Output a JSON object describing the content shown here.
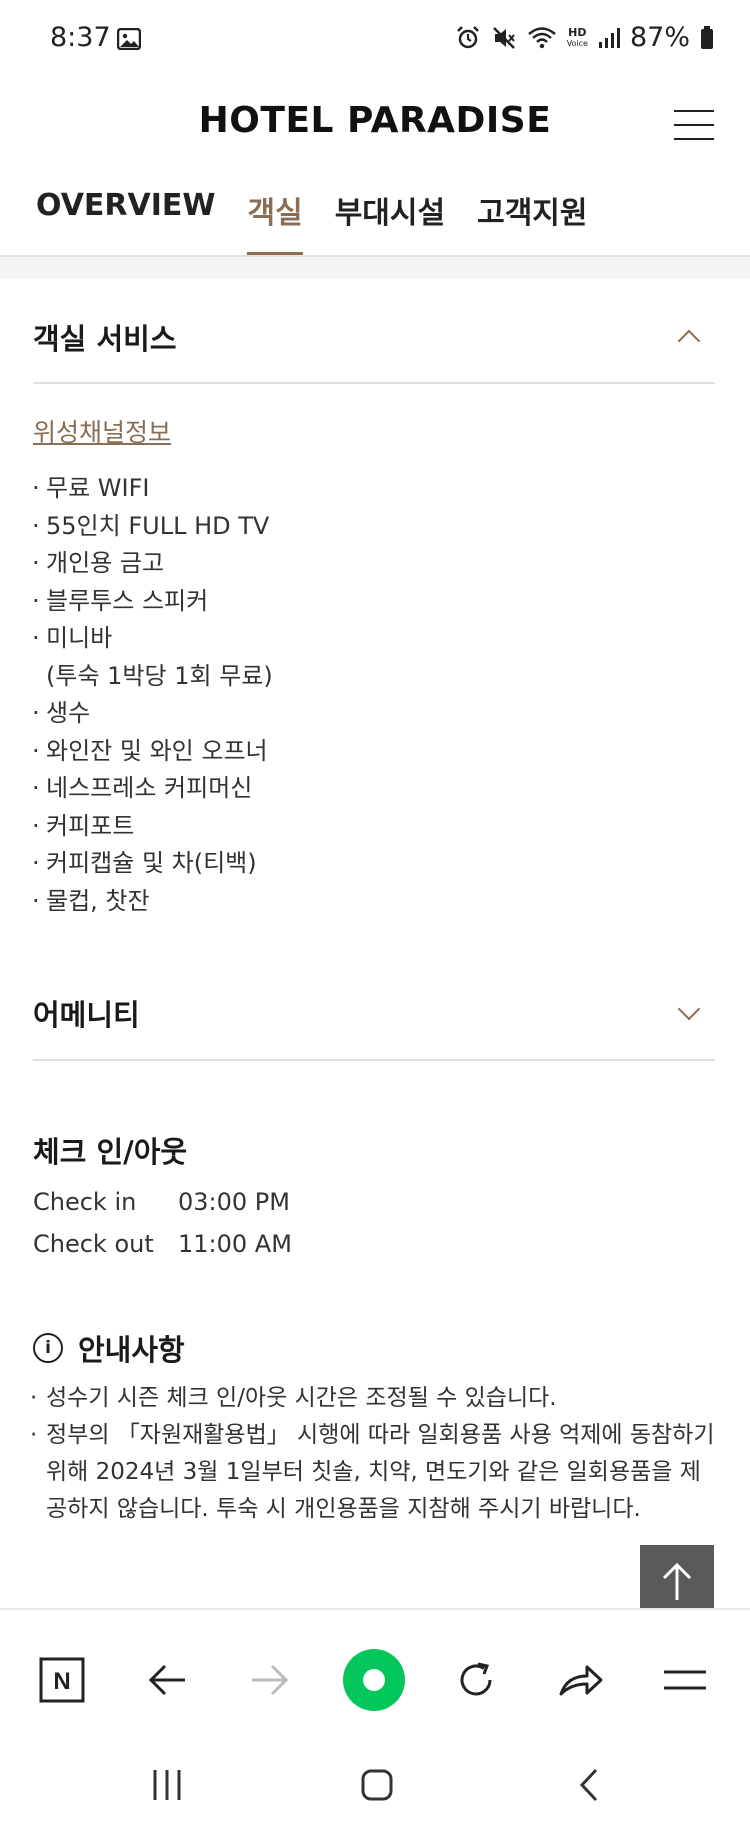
{
  "status_bar": {
    "time": "8:37",
    "battery": "87%",
    "hd_label": "HD",
    "voice_label": "Voice"
  },
  "header": {
    "brand": "HOTEL PARADISE"
  },
  "tabs": [
    {
      "label": "OVERVIEW",
      "active": false
    },
    {
      "label": "객실",
      "active": true
    },
    {
      "label": "부대시설",
      "active": false
    },
    {
      "label": "고객지원",
      "active": false
    }
  ],
  "room_service": {
    "title": "객실 서비스",
    "link": "위성채널정보",
    "items": [
      "무료 WIFI",
      "55인치 FULL HD TV",
      "개인용 금고",
      "블루투스 스피커",
      "미니바",
      "생수",
      "와인잔 및 와인 오프너",
      "네스프레소 커피머신",
      "커피포트",
      "커피캡슐 및 차(티백)",
      "물컵, 찻잔"
    ],
    "minibar_note": "(투숙 1박당 1회 무료)"
  },
  "amenity": {
    "title": "어메니티"
  },
  "checkinout": {
    "title": "체크 인/아웃",
    "checkin_label": "Check in",
    "checkin_time": "03:00 PM",
    "checkout_label": "Check out",
    "checkout_time": "11:00 AM"
  },
  "notice": {
    "title": "안내사항",
    "icon_glyph": "i",
    "items": [
      "성수기 시즌 체크 인/아웃 시간은 조정될 수 있습니다.",
      "정부의 「자원재활용법」 시행에 따라 일회용품 사용 억제에 동참하기 위해 2024년 3월 1일부터 칫솔, 치약, 면도기와 같은 일회용품을 제공하지 않습니다. 투숙 시 개인용품을 지참해 주시기 바랍니다."
    ]
  },
  "browser_bar": {
    "home_glyph": "N"
  },
  "colors": {
    "accent": "#8a6d52",
    "naver_green": "#03c75a",
    "totop_bg": "#5a5a5a"
  }
}
